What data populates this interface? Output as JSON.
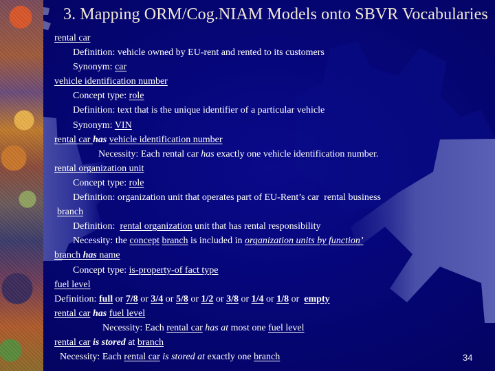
{
  "slide": {
    "title": "3. Mapping ORM/Cog.NIAM Models onto SBVR Vocabularies",
    "page_number": "34",
    "colors": {
      "background": "#03035e",
      "title_text": "#f2ead6",
      "body_text": "#ffffff",
      "gear_light": "#5a5fb0"
    }
  },
  "lines": [
    {
      "indent": "i0",
      "segments": [
        {
          "text": "rental car",
          "u": true
        }
      ]
    },
    {
      "indent": "i1",
      "segments": [
        {
          "text": "Definition: vehicle owned by EU-rent and rented to its customers"
        }
      ]
    },
    {
      "indent": "i1",
      "segments": [
        {
          "text": "Synonym: "
        },
        {
          "text": "car",
          "u": true
        }
      ]
    },
    {
      "indent": "i0",
      "segments": [
        {
          "text": "vehicle identification number",
          "u": true
        }
      ]
    },
    {
      "indent": "i1",
      "segments": [
        {
          "text": "Concept type: "
        },
        {
          "text": "role",
          "u": true
        }
      ]
    },
    {
      "indent": "i1",
      "segments": [
        {
          "text": "Definition: text that is the unique identifier of a particular vehicle"
        }
      ]
    },
    {
      "indent": "i1",
      "segments": [
        {
          "text": "Synonym: "
        },
        {
          "text": "VIN",
          "u": true
        }
      ]
    },
    {
      "indent": "i0",
      "segments": [
        {
          "text": "rental car ",
          "u": true
        },
        {
          "text": "has",
          "b": true,
          "it": true
        },
        {
          "text": " "
        },
        {
          "text": "vehicle identification number",
          "u": true
        }
      ]
    },
    {
      "indent": "i2",
      "segments": [
        {
          "text": "Necessity: Each rental car "
        },
        {
          "text": "has",
          "it": true
        },
        {
          "text": " exactly one vehicle identification number."
        }
      ]
    },
    {
      "indent": "i0",
      "segments": [
        {
          "text": "rental organization unit",
          "u": true
        }
      ]
    },
    {
      "indent": "i1",
      "segments": [
        {
          "text": "Concept type: "
        },
        {
          "text": "role",
          "u": true
        }
      ]
    },
    {
      "indent": "i1",
      "segments": [
        {
          "text": "Definition: organization unit that operates part of EU-Rent’s car  rental business"
        }
      ]
    },
    {
      "indent": "i0b",
      "segments": [
        {
          "text": "branch",
          "u": true
        }
      ]
    },
    {
      "indent": "i1",
      "segments": [
        {
          "text": "Definition:  "
        },
        {
          "text": "rental organization",
          "u": true
        },
        {
          "text": " unit that has rental responsibility"
        }
      ]
    },
    {
      "indent": "i1",
      "segments": [
        {
          "text": "Necessity: the "
        },
        {
          "text": "concept",
          "u": true
        },
        {
          "text": " "
        },
        {
          "text": "branch",
          "u": true
        },
        {
          "text": " is included in "
        },
        {
          "text": "organization units by function’",
          "u": true,
          "it": true
        }
      ]
    },
    {
      "indent": "i0",
      "segments": [
        {
          "text": "branch ",
          "u": true
        },
        {
          "text": "has",
          "b": true,
          "it": true,
          "u": true
        },
        {
          "text": " name",
          "u": true
        }
      ]
    },
    {
      "indent": "i1",
      "segments": [
        {
          "text": "Concept type: "
        },
        {
          "text": "is-property-of fact type",
          "u": true
        }
      ]
    },
    {
      "indent": "i0",
      "segments": [
        {
          "text": "fuel level",
          "u": true
        }
      ]
    },
    {
      "indent": "i0",
      "segments": [
        {
          "text": "Definition: "
        },
        {
          "text": "full",
          "b": true,
          "u": true
        },
        {
          "text": " or "
        },
        {
          "text": "7/8",
          "b": true,
          "u": true
        },
        {
          "text": " or "
        },
        {
          "text": "3/4",
          "b": true,
          "u": true
        },
        {
          "text": " or "
        },
        {
          "text": "5/8",
          "b": true,
          "u": true
        },
        {
          "text": " or "
        },
        {
          "text": "1/2",
          "b": true,
          "u": true
        },
        {
          "text": " or "
        },
        {
          "text": "3/8",
          "b": true,
          "u": true
        },
        {
          "text": " or "
        },
        {
          "text": "1/4",
          "b": true,
          "u": true
        },
        {
          "text": " or "
        },
        {
          "text": "1/8",
          "b": true,
          "u": true
        },
        {
          "text": " or  "
        },
        {
          "text": "empty",
          "b": true,
          "u": true
        }
      ]
    },
    {
      "indent": "i0",
      "segments": [
        {
          "text": "rental car",
          "u": true
        },
        {
          "text": " "
        },
        {
          "text": "has",
          "b": true,
          "it": true
        },
        {
          "text": " "
        },
        {
          "text": "fuel level",
          "u": true
        }
      ]
    },
    {
      "indent": "i3",
      "segments": [
        {
          "text": "Necessity: Each "
        },
        {
          "text": "rental car",
          "u": true
        },
        {
          "text": " "
        },
        {
          "text": "has at",
          "it": true
        },
        {
          "text": " most one "
        },
        {
          "text": "fuel level",
          "u": true
        }
      ]
    },
    {
      "indent": "i0",
      "segments": [
        {
          "text": "rental car",
          "u": true
        },
        {
          "text": " "
        },
        {
          "text": "is stored",
          "b": true,
          "it": true
        },
        {
          "text": " at "
        },
        {
          "text": "branch",
          "u": true
        }
      ]
    },
    {
      "indent": "i0c",
      "segments": [
        {
          "text": "Necessity: Each "
        },
        {
          "text": "rental car",
          "u": true
        },
        {
          "text": " "
        },
        {
          "text": "is stored at",
          "it": true
        },
        {
          "text": " exactly one "
        },
        {
          "text": "branch",
          "u": true
        }
      ]
    }
  ]
}
